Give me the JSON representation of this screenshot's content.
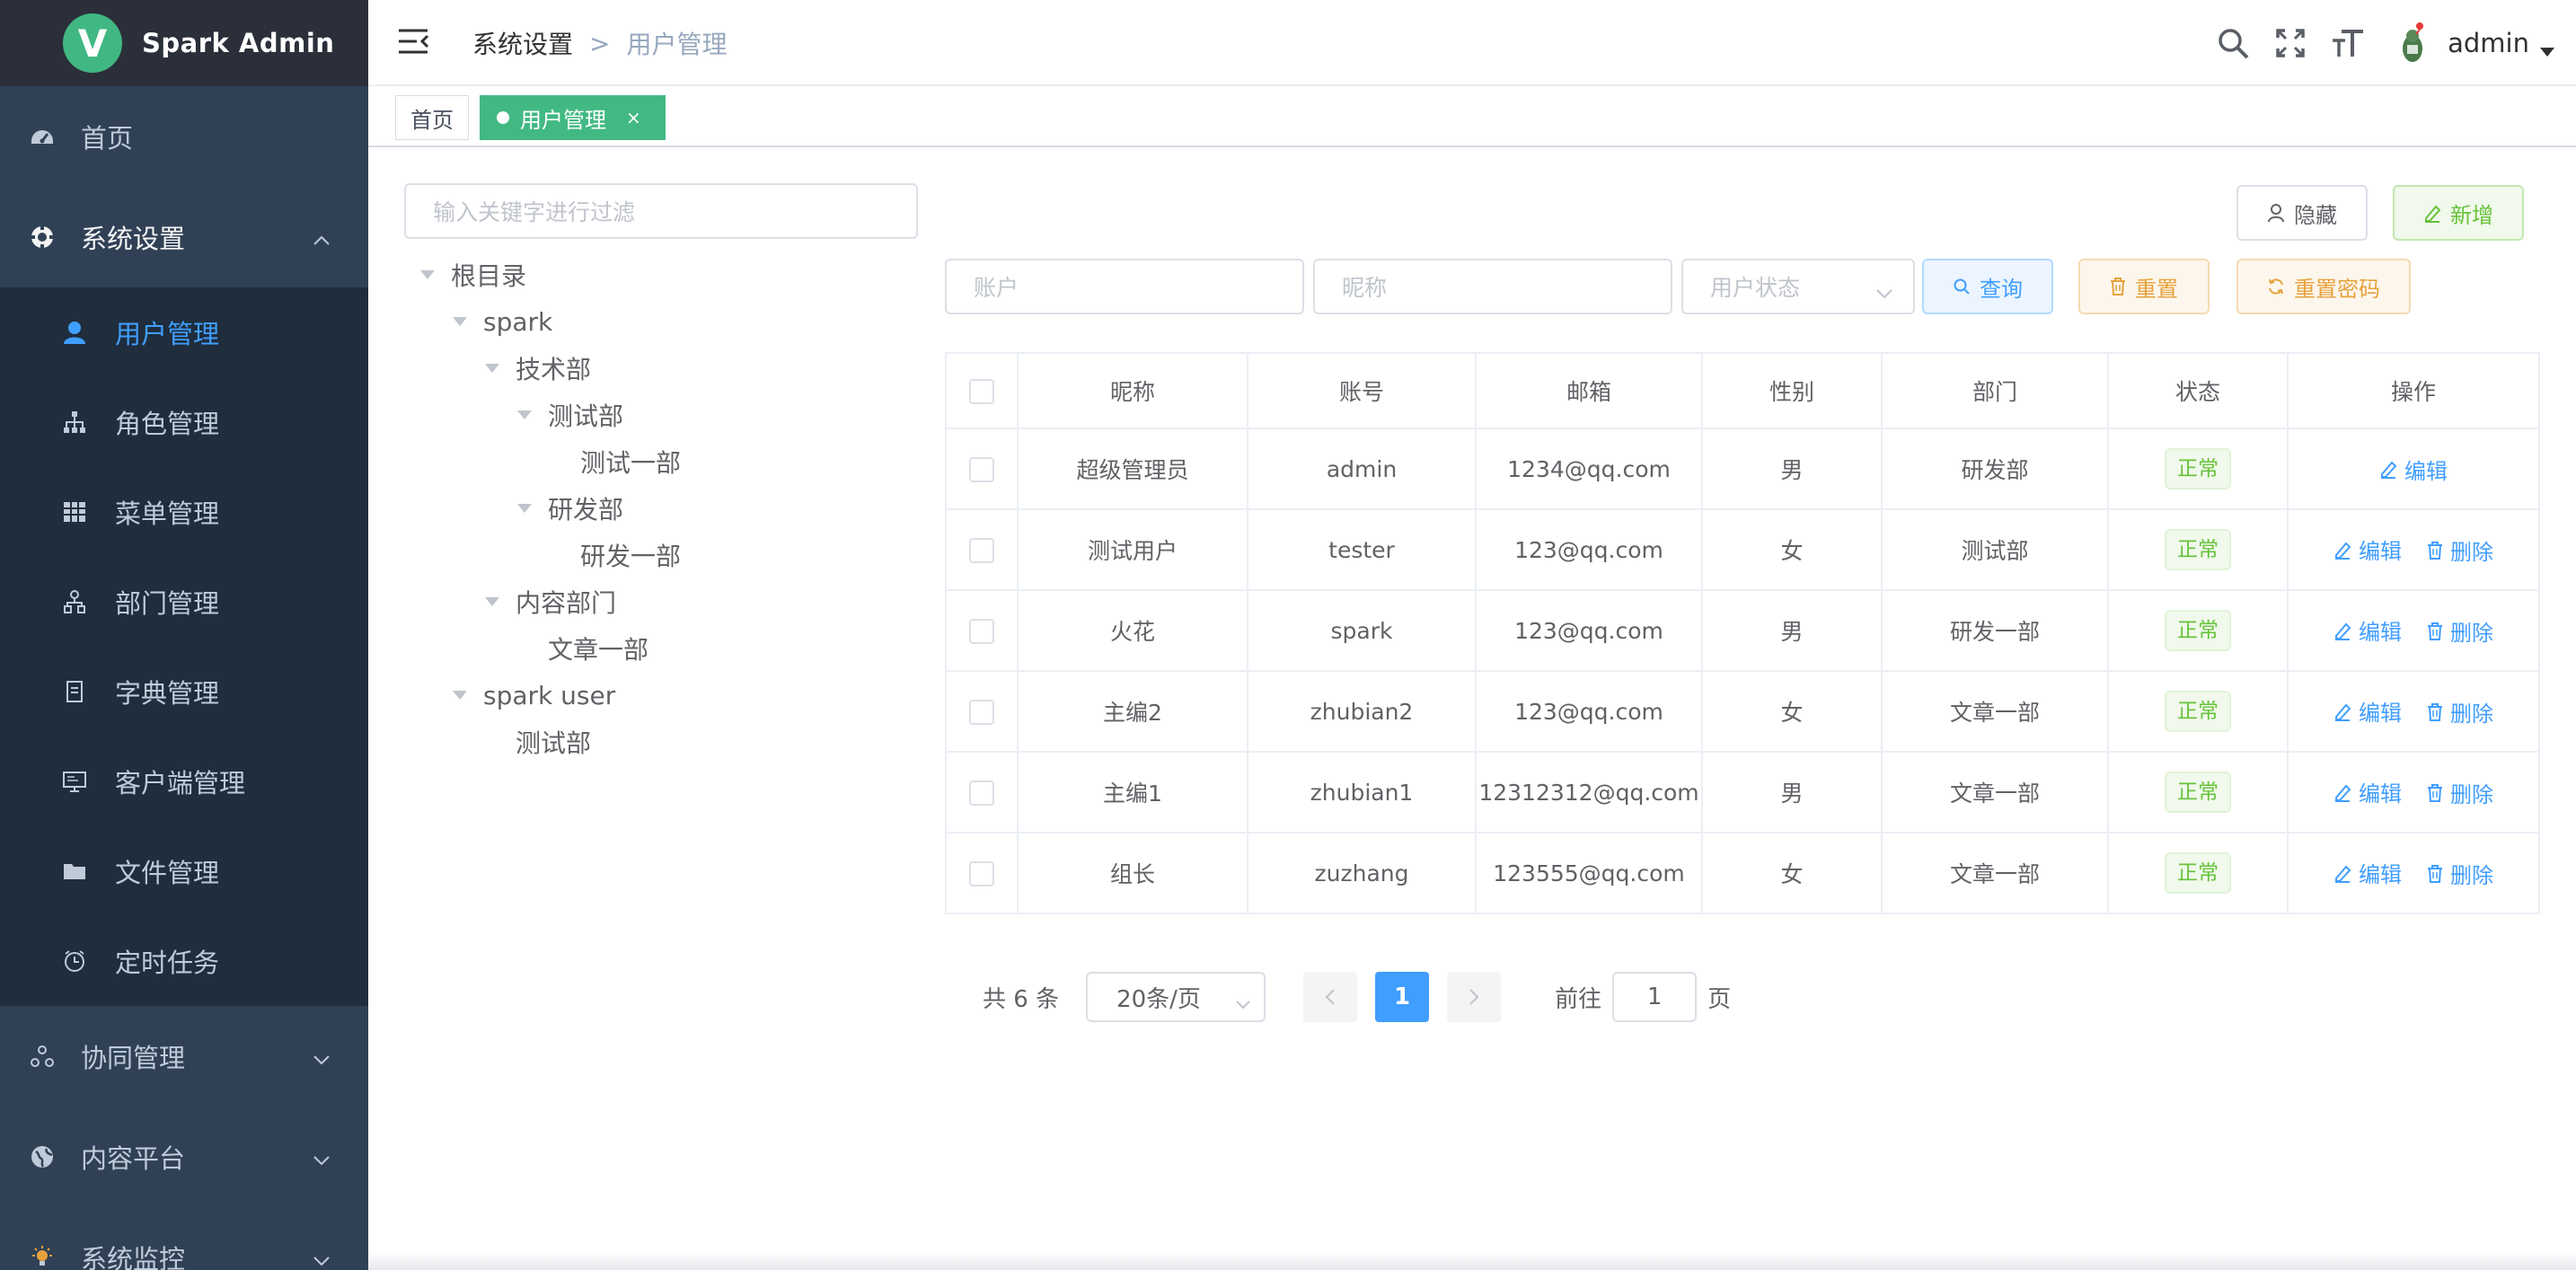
{
  "app": {
    "name": "Spark Admin",
    "logo_letter": "V"
  },
  "sidebar": {
    "home": "首页",
    "system": {
      "label": "系统设置",
      "items": [
        "用户管理",
        "角色管理",
        "菜单管理",
        "部门管理",
        "字典管理",
        "客户端管理",
        "文件管理",
        "定时任务"
      ],
      "active": "用户管理"
    },
    "collab": "协同管理",
    "content": "内容平台",
    "monitor": "系统监控"
  },
  "header": {
    "breadcrumb": [
      "系统设置",
      "用户管理"
    ],
    "breadcrumb_sep": ">",
    "username": "admin"
  },
  "tags": {
    "home": "首页",
    "active": "用户管理",
    "close": "×"
  },
  "tree": {
    "filter_placeholder": "输入关键字进行过滤",
    "nodes": [
      {
        "label": "根目录",
        "level": 0,
        "expanded": true
      },
      {
        "label": "spark",
        "level": 1,
        "expanded": true
      },
      {
        "label": "技术部",
        "level": 2,
        "expanded": true
      },
      {
        "label": "测试部",
        "level": 3,
        "expanded": true
      },
      {
        "label": "测试一部",
        "level": 4,
        "expanded": false
      },
      {
        "label": "研发部",
        "level": 3,
        "expanded": true
      },
      {
        "label": "研发一部",
        "level": 4,
        "expanded": false
      },
      {
        "label": "内容部门",
        "level": 2,
        "expanded": true
      },
      {
        "label": "文章一部",
        "level": 3,
        "expanded": false
      },
      {
        "label": "spark user",
        "level": 1,
        "expanded": true
      },
      {
        "label": "测试部",
        "level": 2,
        "expanded": false
      }
    ]
  },
  "toolbar": {
    "hide": "隐藏",
    "add": "新增",
    "account_placeholder": "账户",
    "nickname_placeholder": "昵称",
    "status_placeholder": "用户状态",
    "query": "查询",
    "reset": "重置",
    "reset_password": "重置密码"
  },
  "table": {
    "columns": [
      "昵称",
      "账号",
      "邮箱",
      "性别",
      "部门",
      "状态",
      "操作"
    ],
    "edit": "编辑",
    "delete": "删除",
    "rows": [
      {
        "nickname": "超级管理员",
        "account": "admin",
        "email": "1234@qq.com",
        "gender": "男",
        "dept": "研发部",
        "status": "正常",
        "can_delete": false
      },
      {
        "nickname": "测试用户",
        "account": "tester",
        "email": "123@qq.com",
        "gender": "女",
        "dept": "测试部",
        "status": "正常",
        "can_delete": true
      },
      {
        "nickname": "火花",
        "account": "spark",
        "email": "123@qq.com",
        "gender": "男",
        "dept": "研发一部",
        "status": "正常",
        "can_delete": true
      },
      {
        "nickname": "主编2",
        "account": "zhubian2",
        "email": "123@qq.com",
        "gender": "女",
        "dept": "文章一部",
        "status": "正常",
        "can_delete": true
      },
      {
        "nickname": "主编1",
        "account": "zhubian1",
        "email": "12312312@qq.com",
        "gender": "男",
        "dept": "文章一部",
        "status": "正常",
        "can_delete": true
      },
      {
        "nickname": "组长",
        "account": "zuzhang",
        "email": "123555@qq.com",
        "gender": "女",
        "dept": "文章一部",
        "status": "正常",
        "can_delete": true
      }
    ]
  },
  "pagination": {
    "total": "共 6 条",
    "page_size": "20条/页",
    "current": "1",
    "goto_label": "前往",
    "goto_value": "1",
    "page_suffix": "页"
  },
  "colors": {
    "sidebar_bg": "#304156",
    "logo_bg": "#2b2f3a",
    "submenu_bg": "#1f2d3d",
    "active": "#409eff",
    "tag_active": "#42b983",
    "success": "#67c23a",
    "warning": "#e6a23c"
  }
}
